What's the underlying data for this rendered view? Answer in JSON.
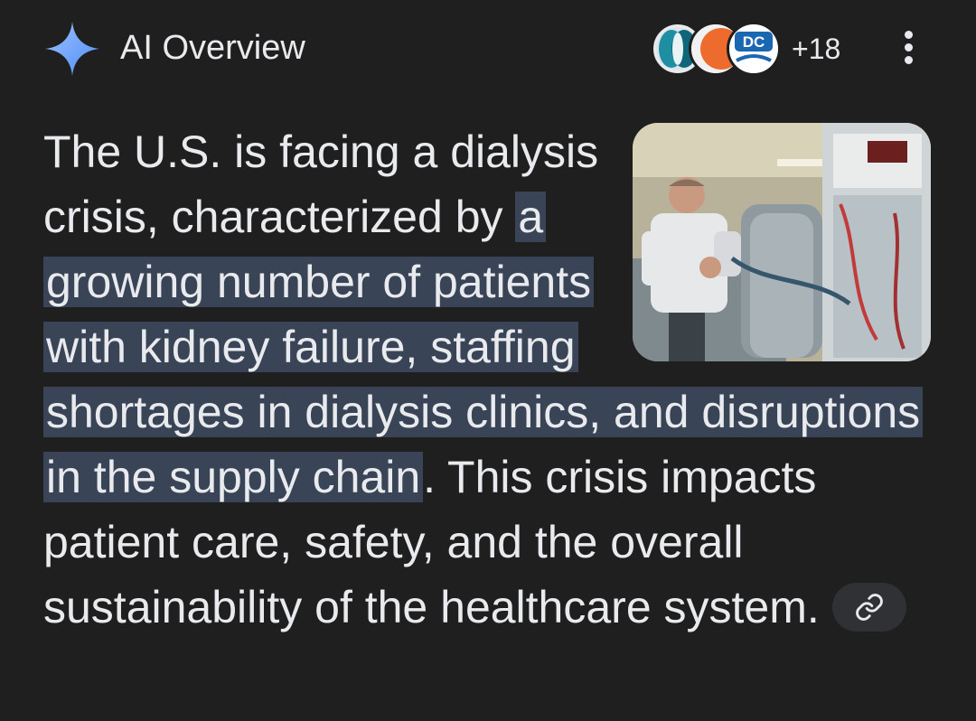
{
  "header": {
    "title": "AI Overview",
    "sparkle_icon": "sparkle-icon",
    "source_count": "+18",
    "sources": [
      {
        "icon": "source-logo-blue-ring"
      },
      {
        "icon": "source-logo-orange-circle"
      },
      {
        "icon": "source-logo-dc",
        "text": "DC"
      }
    ],
    "menu_icon": "more-vert-icon"
  },
  "overview": {
    "text_before": "The U.S. is facing a dialysis crisis, characterized by ",
    "highlight": "a growing number of patients with kidney failure, staffing shortages in dialysis clinics, and disruptions in the supply chain",
    "text_after": ". This crisis impacts patient care, safety, and the overall sustainability of the healthcare system.",
    "image_icon": "dialysis-patient-photo",
    "link_icon": "link-icon"
  },
  "colors": {
    "background": "#1f1f1f",
    "text": "#e8eaed",
    "highlight": "#394457",
    "chip": "#303134",
    "sparkle": "#8ab4f8"
  }
}
